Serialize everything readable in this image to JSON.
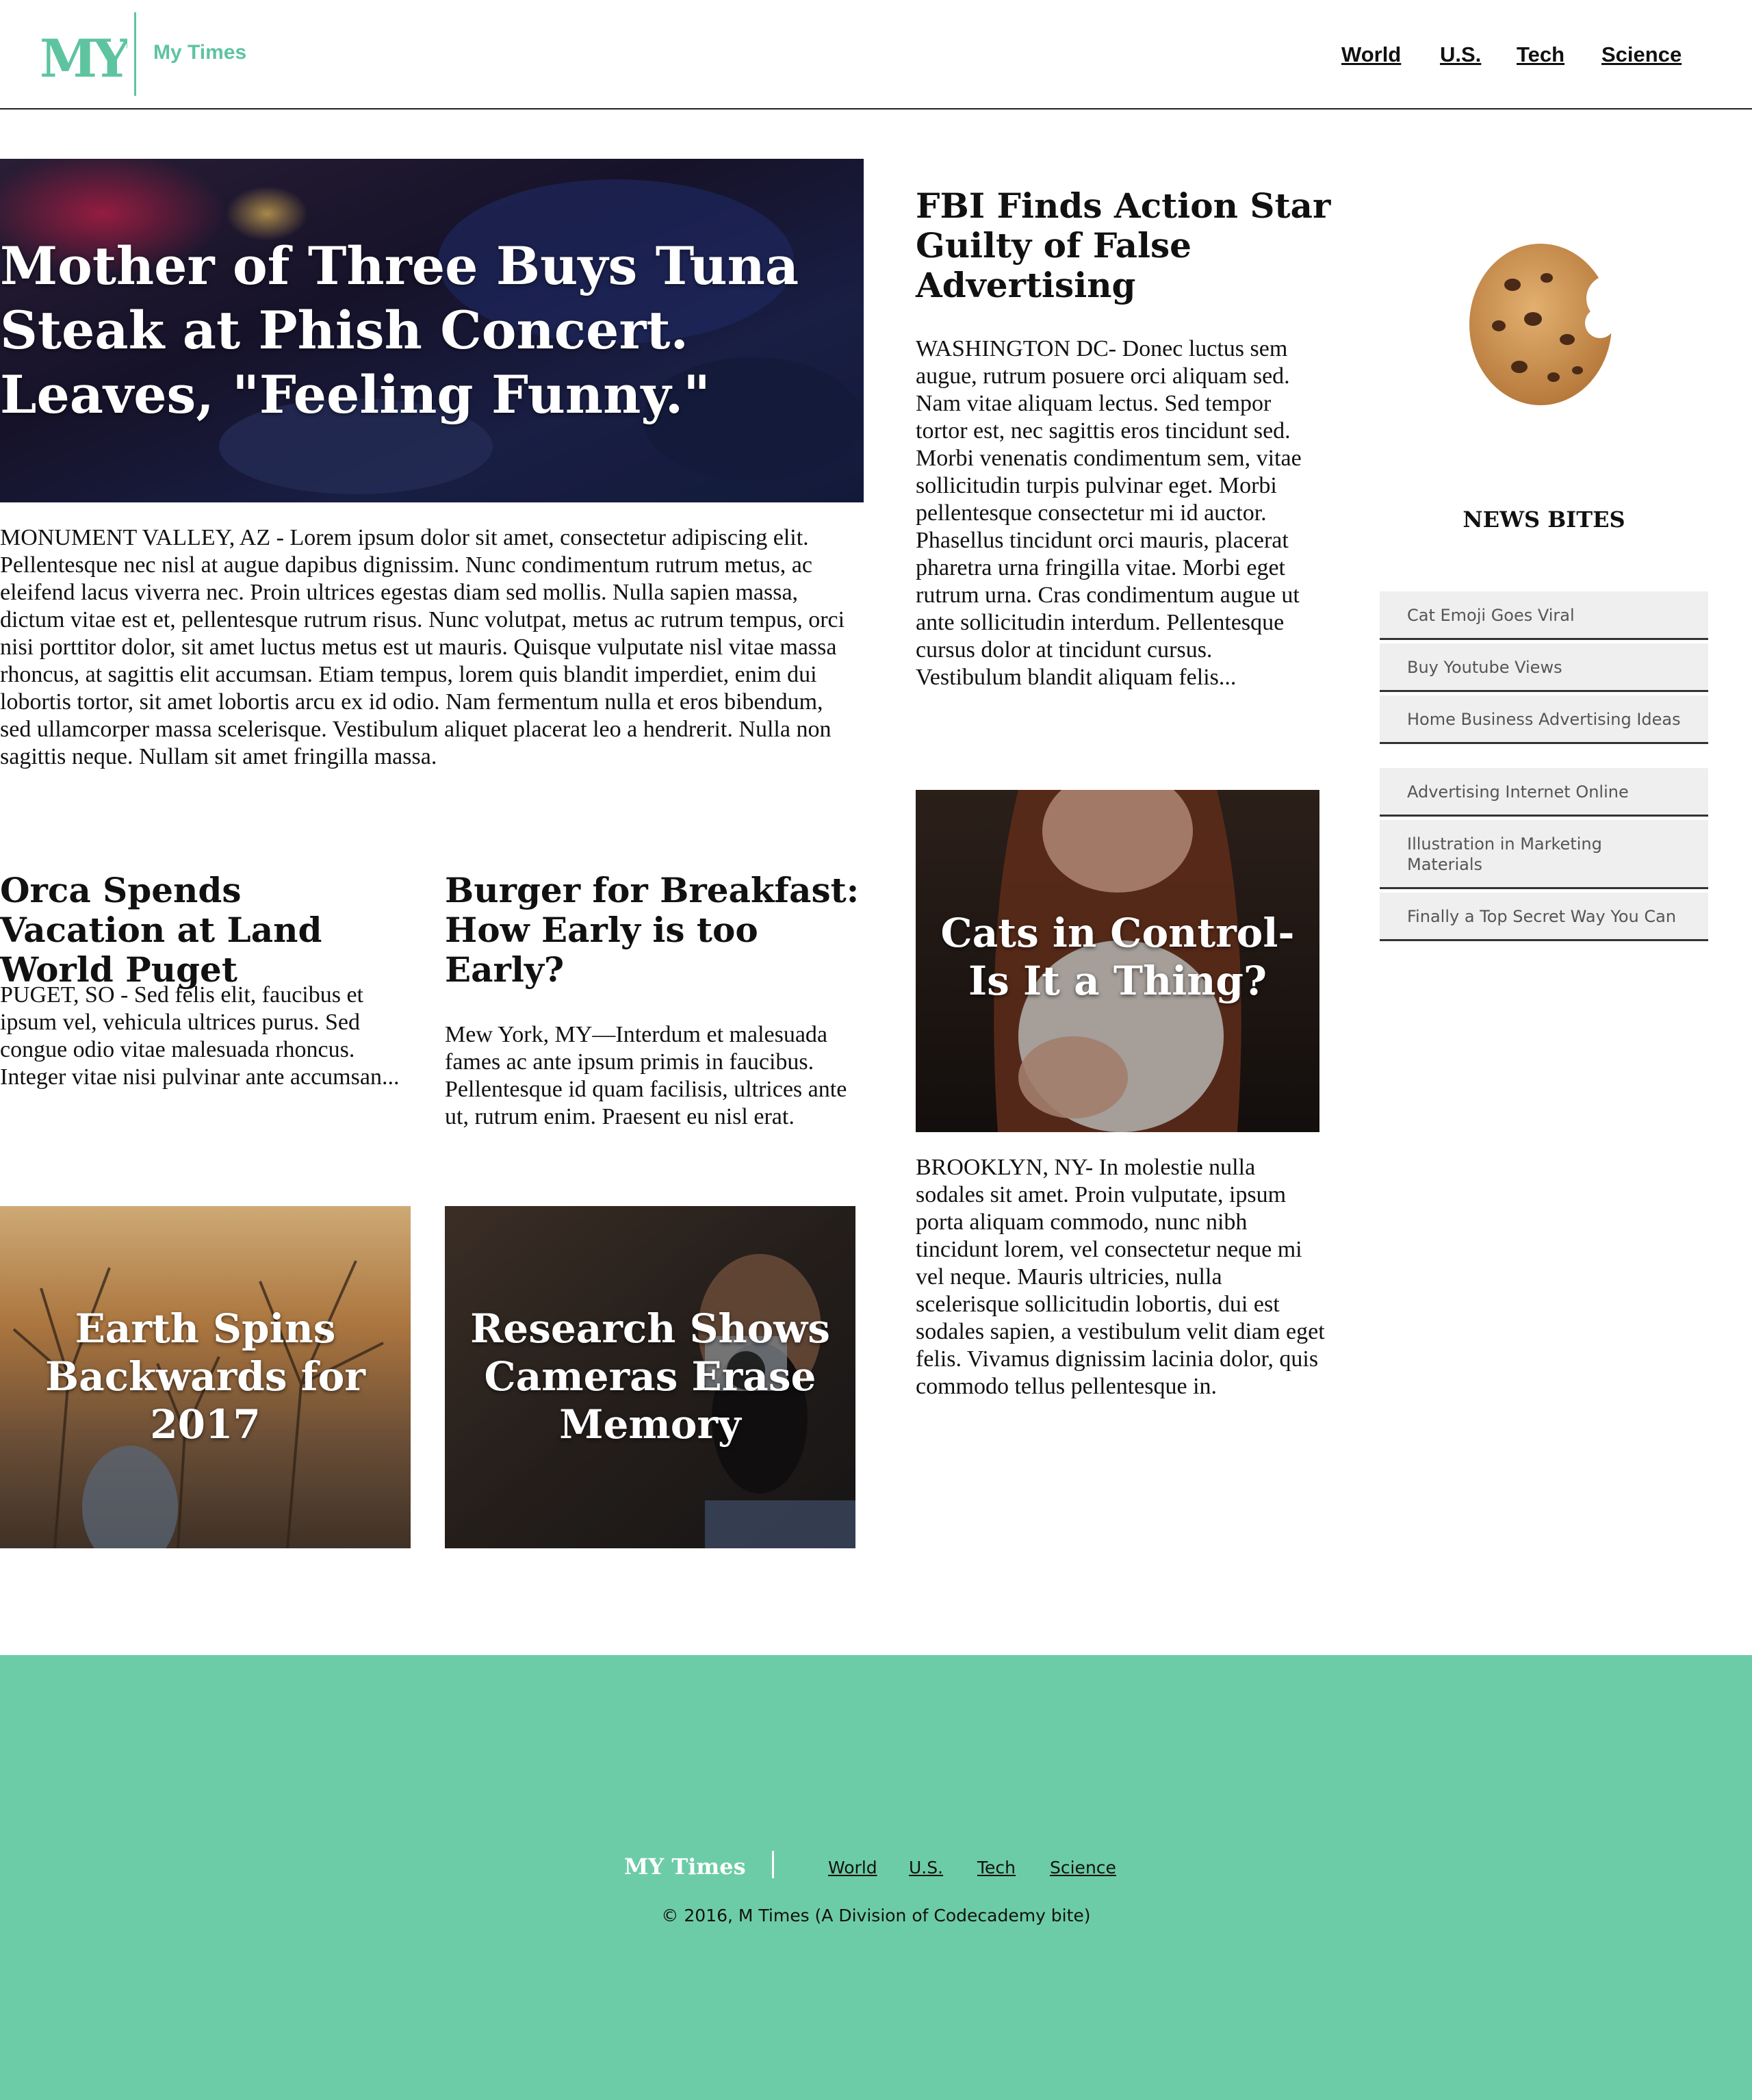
{
  "header": {
    "logo_mark": "MYT",
    "logo_text": "My Times",
    "nav": [
      "World",
      "U.S.",
      "Tech",
      "Science"
    ]
  },
  "hero": {
    "title": "Mother of Three Buys Tuna Steak at Phish Concert. Leaves, \"Feeling Funny.\"",
    "body": "MONUMENT VALLEY, AZ - Lorem ipsum dolor sit amet, consectetur adipiscing elit. Pellentesque nec nisl at augue dapibus dignissim. Nunc condimentum rutrum metus, ac eleifend lacus viverra nec. Proin ultrices egestas diam sed mollis. Nulla sapien massa, dictum vitae est et, pellentesque rutrum risus. Nunc volutpat, metus ac rutrum tempus, orci nisi porttitor dolor, sit amet luctus metus est ut mauris. Quisque vulputate nisl vitae massa rhoncus, at sagittis elit accumsan. Etiam tempus, lorem quis blandit imperdiet, enim dui lobortis tortor, sit amet lobortis arcu ex id odio. Nam fermentum nulla et eros bibendum, sed ullamcorper massa scelerisque. Vestibulum aliquet placerat leo a hendrerit. Nulla non sagittis neque. Nullam sit amet fringilla massa."
  },
  "articles": {
    "orca": {
      "title": "Orca Spends Vacation at Land World Puget",
      "body": "PUGET, SO - Sed felis elit, faucibus et ipsum vel, vehicula ultrices purus. Sed congue odio vitae malesuada rhoncus. Integer vitae nisi pulvinar ante accumsan..."
    },
    "burger": {
      "title": "Burger for Breakfast: How Early is too Early?",
      "body": "Mew York, MY—Interdum et malesuada fames ac ante ipsum primis in faucibus. Pellentesque id quam facilisis, ultrices ante ut, rutrum enim. Praesent eu nisl erat."
    },
    "fbi": {
      "title": "FBI Finds Action Star Guilty of False Advertising",
      "body": "WASHINGTON DC- Donec luctus sem augue, rutrum posuere orci aliquam sed. Nam vitae aliquam lectus. Sed tempor tortor est, nec sagittis eros tincidunt sed. Morbi venenatis condimentum sem, vitae sollicitudin turpis pulvinar eget. Morbi pellentesque consectetur mi id auctor. Phasellus tincidunt orci mauris, placerat pharetra urna fringilla vitae. Morbi eget rutrum urna. Cras condimentum augue ut ante sollicitudin interdum. Pellentesque cursus dolor at tincidunt cursus. Vestibulum blandit aliquam felis..."
    },
    "cats": {
      "title": "Cats in Control-Is It a Thing?",
      "body": "BROOKLYN, NY- In molestie nulla sodales sit amet. Proin vulputate, ipsum porta aliquam commodo, nunc nibh tincidunt lorem, vel consectetur neque mi vel neque. Mauris ultricies, nulla scelerisque sollicitudin lobortis, dui est sodales sapien, a vestibulum velit diam eget felis. Vivamus dignissim lacinia dolor, quis commodo tellus pellentesque in."
    },
    "earth": {
      "title": "Earth Spins Backwards for 2017"
    },
    "research": {
      "title": "Research Shows Cameras Erase Memory"
    }
  },
  "sidebar": {
    "title": "NEWS BITES",
    "items": [
      "Cat Emoji Goes Viral",
      "Buy Youtube Views",
      "Home Business Advertising Ideas",
      "Advertising Internet Online",
      "Illustration in Marketing Materials",
      "Finally a Top Secret Way You Can"
    ]
  },
  "footer": {
    "logo": "MY Times",
    "nav": [
      "World",
      "U.S.",
      "Tech",
      "Science"
    ],
    "copyright": "© 2016, M Times (A Division of Codecademy bite)"
  },
  "colors": {
    "brand": "#5ec4a0",
    "footer_bg": "#6ccca8",
    "sidebar_item_bg": "#efefef"
  }
}
